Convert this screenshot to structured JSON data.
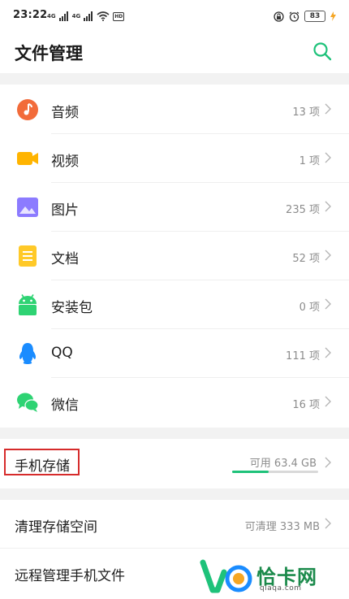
{
  "status_bar": {
    "time": "23:22",
    "sim1_network": "4G",
    "sim2_network": "4G",
    "hd_label": "HD",
    "battery_level": "83",
    "charging": true
  },
  "header": {
    "title": "文件管理",
    "search_icon": "search-icon",
    "accent_color": "#1ec27a"
  },
  "categories": [
    {
      "key": "audio",
      "label": "音频",
      "count": "13 项",
      "icon": "music-icon",
      "color": "#f26b3a"
    },
    {
      "key": "video",
      "label": "视频",
      "count": "1 项",
      "icon": "video-camera-icon",
      "color": "#ffb400"
    },
    {
      "key": "image",
      "label": "图片",
      "count": "235 项",
      "icon": "picture-icon",
      "color": "#8c7bff"
    },
    {
      "key": "document",
      "label": "文档",
      "count": "52 项",
      "icon": "document-icon",
      "color": "#ffc928"
    },
    {
      "key": "apk",
      "label": "安装包",
      "count": "0 项",
      "icon": "android-icon",
      "color": "#2ed373"
    },
    {
      "key": "qq",
      "label": "QQ",
      "count": "111 项",
      "icon": "qq-penguin-icon",
      "color": "#1a8cff"
    },
    {
      "key": "wechat",
      "label": "微信",
      "count": "16 项",
      "icon": "wechat-icon",
      "color": "#2ed373"
    }
  ],
  "storage": {
    "label": "手机存储",
    "available": "可用 63.4 GB",
    "used_fraction": 0.42,
    "bar_color": "#1ec27a"
  },
  "cleanup": {
    "label": "清理存储空间",
    "value": "可清理 333 MB"
  },
  "remote": {
    "label": "远程管理手机文件"
  },
  "watermark": {
    "text": "恰卡网",
    "sub": "qiaqa.com"
  }
}
